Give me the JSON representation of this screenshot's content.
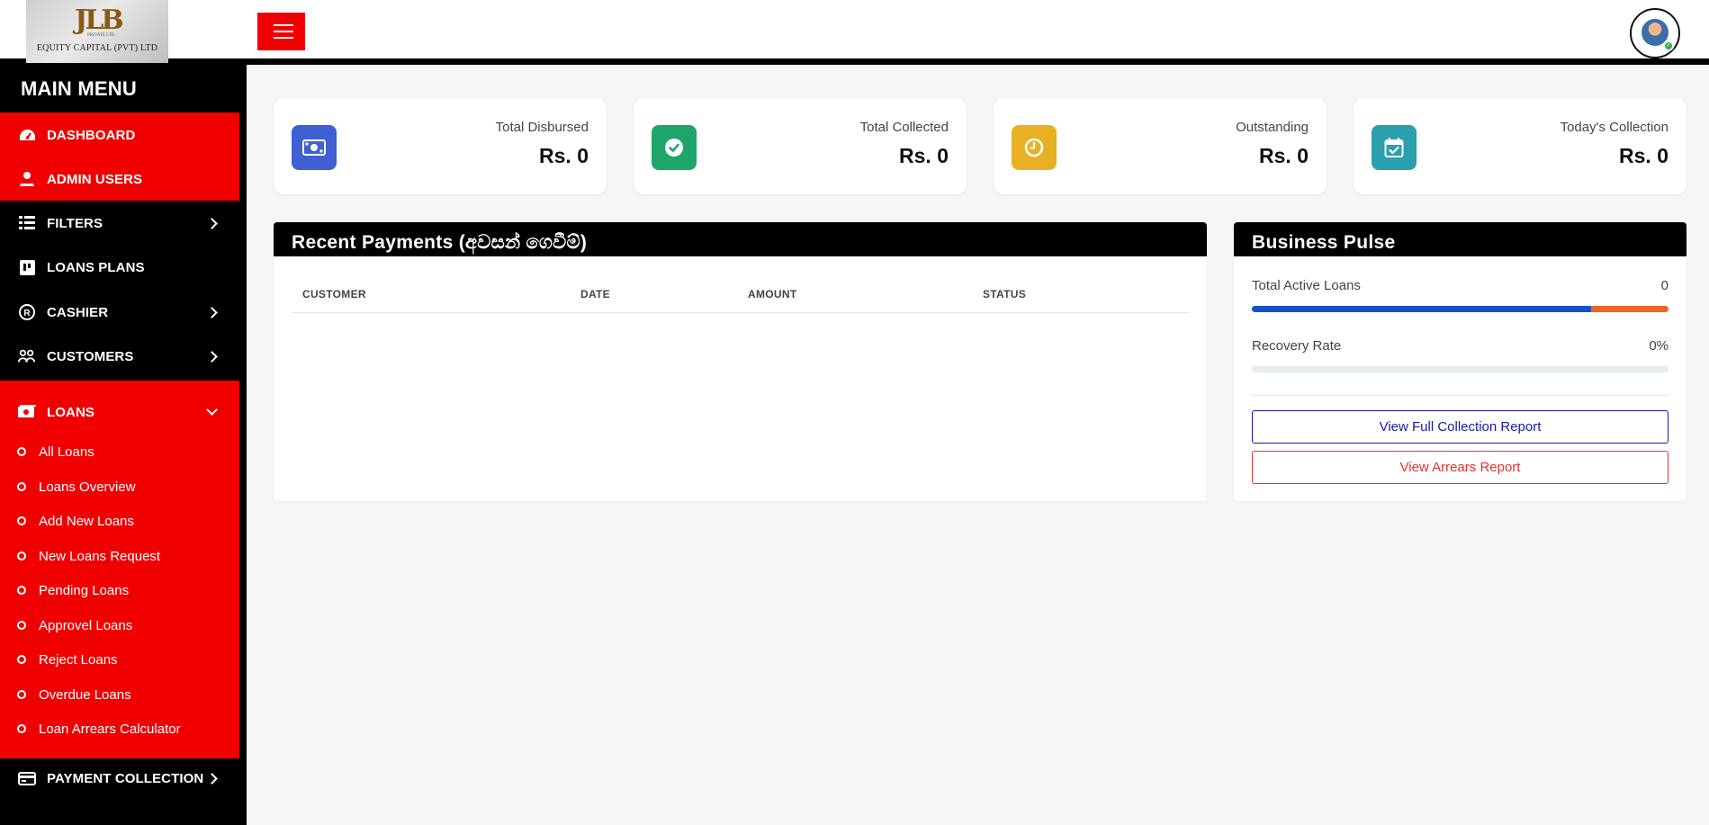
{
  "header": {
    "logo_mark": "JLB",
    "logo_sub": "PRIVATE LTD",
    "logo_name": "EQUITY CAPITAL (PVT) LTD"
  },
  "sidebar": {
    "title": "MAIN MENU",
    "items": [
      {
        "label": "DASHBOARD",
        "icon": "dashboard-icon"
      },
      {
        "label": "ADMIN USERS",
        "icon": "users-icon"
      },
      {
        "label": "FILTERS",
        "icon": "filter-icon"
      },
      {
        "label": "LOANS PLANS",
        "icon": "plans-icon"
      },
      {
        "label": "CASHIER",
        "icon": "cashier-icon"
      },
      {
        "label": "CUSTOMERS",
        "icon": "customers-icon"
      },
      {
        "label": "LOANS",
        "icon": "money-icon"
      },
      {
        "label": "PAYMENT COLLECTION",
        "icon": "payment-icon"
      }
    ],
    "loan_subitems": [
      "All Loans",
      "Loans Overview",
      "Add New Loans",
      "New Loans Request",
      "Pending Loans",
      "Approvel Loans",
      "Reject Loans",
      "Overdue Loans",
      "Loan Arrears Calculator"
    ]
  },
  "stats": [
    {
      "label": "Total Disbursed",
      "value": "Rs. 0",
      "icon": "cash-icon",
      "color": "#3f5fd3"
    },
    {
      "label": "Total Collected",
      "value": "Rs. 0",
      "icon": "check-circle-icon",
      "color": "#1ea66a"
    },
    {
      "label": "Outstanding",
      "value": "Rs. 0",
      "icon": "clock-icon",
      "color": "#e8b124"
    },
    {
      "label": "Today's Collection",
      "value": "Rs. 0",
      "icon": "calendar-check-icon",
      "color": "#2a9fae"
    }
  ],
  "recent_payments": {
    "title": "Recent Payments (අවසන් ගෙවීම්)",
    "columns": [
      "CUSTOMER",
      "DATE",
      "AMOUNT",
      "STATUS"
    ],
    "rows": []
  },
  "business_pulse": {
    "title": "Business Pulse",
    "active_loans_label": "Total Active Loans",
    "active_loans_value": "0",
    "active_loans_bar": {
      "primary_fraction": 0.815,
      "primary_color": "#1550c8",
      "secondary_color": "#ef6424"
    },
    "recovery_label": "Recovery Rate",
    "recovery_value": "0%",
    "recovery_fraction": 0,
    "btn_collection": "View Full Collection Report",
    "btn_arrears": "View Arrears Report"
  },
  "colors": {
    "brand_red": "#f00000",
    "sidebar_bg": "#000000"
  }
}
